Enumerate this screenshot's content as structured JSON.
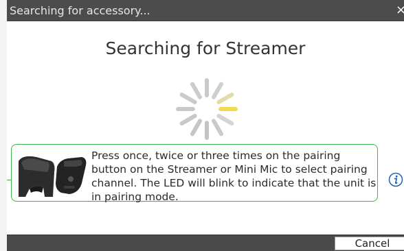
{
  "window": {
    "title": "Searching for accessory...",
    "close_glyph": "×"
  },
  "main": {
    "heading": "Searching for Streamer",
    "spinner_icon": "loading-spinner-icon",
    "info": {
      "text": "Press once, twice or three times on the pairing button on the Streamer or Mini Mic to select pairing channel. The LED will blink to indicate that the unit is in pairing mode.",
      "image": "streamer-and-mini-mic-image"
    },
    "help_icon": "info-icon"
  },
  "footer": {
    "cancel_label": "Cancel"
  },
  "colors": {
    "titlebar": "#4c4c4c",
    "accent_green": "#39b54a",
    "spinner_active": "#f2d94e",
    "spinner_inactive": "#c8c8c8",
    "help_blue": "#1f5fb4"
  }
}
